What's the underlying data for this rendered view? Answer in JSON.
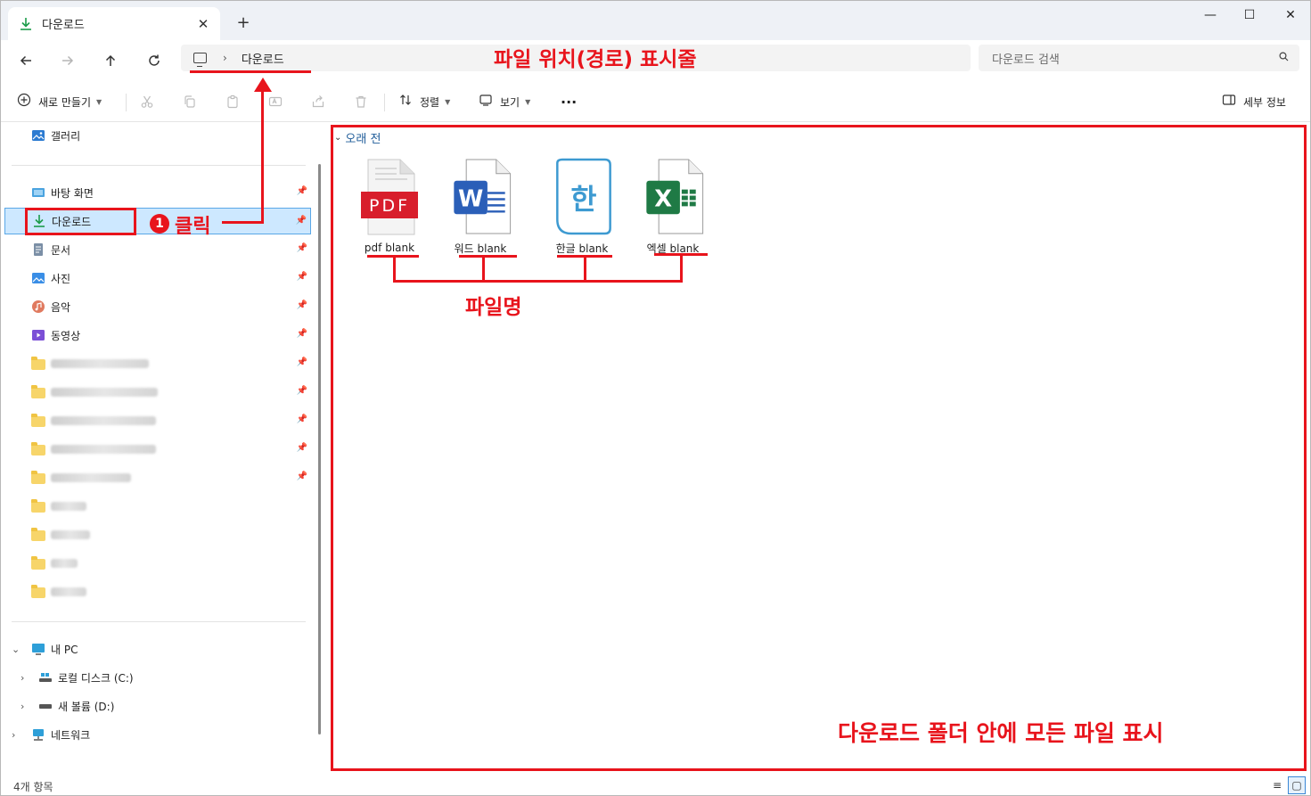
{
  "window": {
    "tab_title": "다운로드",
    "new_tab": "+",
    "controls": {
      "minimize": "—",
      "maximize": "☐",
      "close": "✕"
    }
  },
  "address": {
    "separator": "›",
    "crumb": "다운로드",
    "search_placeholder": "다운로드 검색"
  },
  "toolbar": {
    "new_label": "새로 만들기",
    "sort_label": "정렬",
    "view_label": "보기",
    "more_label": "···",
    "details_label": "세부 정보"
  },
  "sidebar": {
    "gallery": "갤러리",
    "quick": [
      {
        "label": "바탕 화면",
        "icon": "desktop-icon"
      },
      {
        "label": "다운로드",
        "icon": "download-icon",
        "selected": true
      },
      {
        "label": "문서",
        "icon": "document-icon"
      },
      {
        "label": "사진",
        "icon": "picture-icon"
      },
      {
        "label": "음악",
        "icon": "music-icon"
      },
      {
        "label": "동영상",
        "icon": "video-icon"
      }
    ],
    "this_pc": "내 PC",
    "drives": [
      {
        "label": "로컬 디스크 (C:)"
      },
      {
        "label": "새 볼륨 (D:)"
      }
    ],
    "network": "네트워크"
  },
  "content": {
    "group_header": "오래 전",
    "files": [
      {
        "name": "pdf blank",
        "type": "pdf",
        "badge": "PDF",
        "color": "#d81e2c"
      },
      {
        "name": "워드 blank",
        "type": "word",
        "badge": "W",
        "color": "#2b5fb8"
      },
      {
        "name": "한글 blank",
        "type": "hwp",
        "badge": "한",
        "color": "#3d9ad1"
      },
      {
        "name": "엑셀 blank",
        "type": "excel",
        "badge": "X",
        "color": "#1f7a45"
      }
    ]
  },
  "status": {
    "item_count": "4개 항목"
  },
  "annotations": {
    "path_label": "파일 위치(경로) 표시줄",
    "step_number": "1",
    "click_label": "클릭",
    "filename_label": "파일명",
    "folder_label": "다운로드 폴더 안에 모든 파일 표시",
    "color": "#e8141c"
  }
}
